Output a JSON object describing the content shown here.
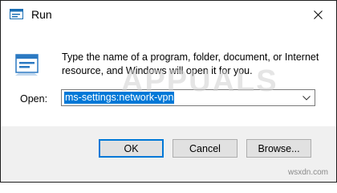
{
  "window": {
    "title": "Run",
    "app_icon": "run-app-icon",
    "close_icon": "close-icon"
  },
  "content": {
    "icon": "run-program-icon",
    "description": "Type the name of a program, folder, document, or Internet resource, and Windows will open it for you.",
    "open_label": "Open:",
    "open_value": "ms-settings:network-vpn",
    "dropdown_icon": "chevron-down-icon"
  },
  "buttons": {
    "ok": "OK",
    "cancel": "Cancel",
    "browse": "Browse..."
  },
  "watermark": {
    "text": "APPUALS"
  },
  "source_label": "wsxdn.com",
  "colors": {
    "selection": "#0078d7",
    "footer_bg": "#f0f0f0",
    "button_bg": "#e1e1e1"
  }
}
